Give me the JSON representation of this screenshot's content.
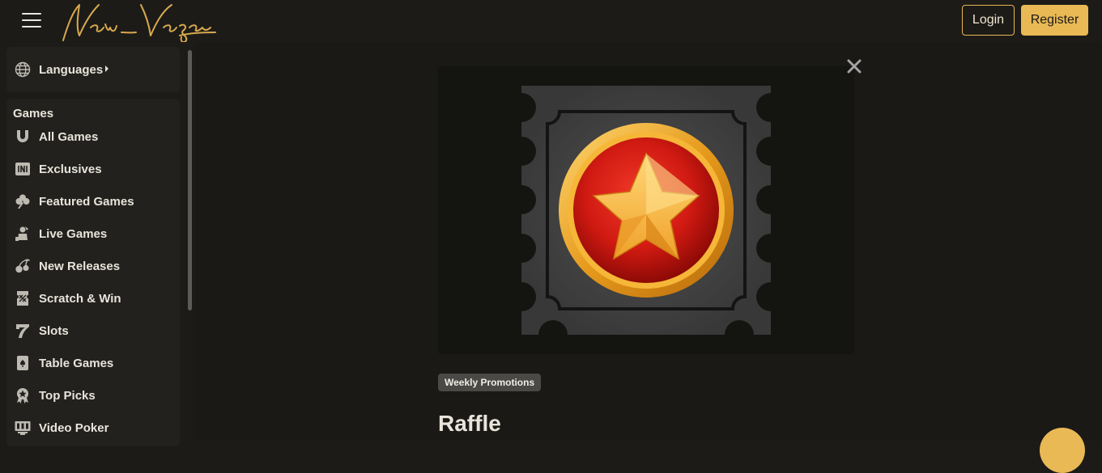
{
  "header": {
    "logo_text": "New Vegas",
    "login_label": "Login",
    "register_label": "Register"
  },
  "sidebar": {
    "languages_label": "Languages",
    "games_heading": "Games",
    "items": [
      {
        "label": "All Games",
        "icon": "horseshoe-icon"
      },
      {
        "label": "Exclusives",
        "icon": "exclusives-icon"
      },
      {
        "label": "Featured Games",
        "icon": "clover-icon"
      },
      {
        "label": "Live Games",
        "icon": "live-dealer-icon"
      },
      {
        "label": "New Releases",
        "icon": "cherries-icon"
      },
      {
        "label": "Scratch & Win",
        "icon": "scratch-ticket-icon"
      },
      {
        "label": "Slots",
        "icon": "seven-icon"
      },
      {
        "label": "Table Games",
        "icon": "playing-card-icon"
      },
      {
        "label": "Top Picks",
        "icon": "award-icon"
      },
      {
        "label": "Video Poker",
        "icon": "video-poker-icon"
      }
    ]
  },
  "promo": {
    "tag": "Weekly Promotions",
    "title": "Raffle",
    "image_icon": "raffle-star-ticket-icon"
  },
  "colors": {
    "accent": "#e9b955",
    "background": "#1c1b18",
    "panel": "#22211e"
  }
}
